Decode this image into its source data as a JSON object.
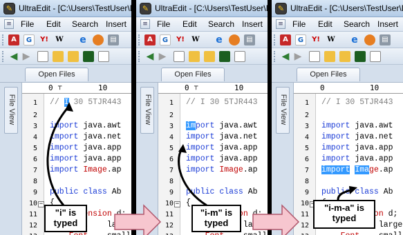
{
  "window": {
    "app_icon": "ultraedit-logo-icon",
    "title": "UltraEdit - [C:\\Users\\TestUser\\D"
  },
  "menu": [
    "File",
    "Edit",
    "Search",
    "Insert"
  ],
  "toolbar1_icons": [
    "acrobat-icon",
    "google-icon",
    "yahoo-icon",
    "wikipedia-icon",
    "ie-icon",
    "firefox-icon",
    "print-icon"
  ],
  "toolbar2_icons": [
    "back-icon",
    "forward-icon",
    "new-file-icon",
    "open-folder-icon",
    "save-icon",
    "copy-icon"
  ],
  "tabs": {
    "open_files": "Open Files"
  },
  "sidebar": {
    "file_view": "File View"
  },
  "ruler": {
    "marks": [
      "0",
      "10"
    ]
  },
  "panels": [
    {
      "lines": [
        {
          "n": "1",
          "text": "// I 30 5TJR443"
        },
        {
          "n": "2",
          "text": ""
        },
        {
          "n": "3",
          "text": "import java.awt"
        },
        {
          "n": "4",
          "text": "import java.net"
        },
        {
          "n": "5",
          "text": "import java.app"
        },
        {
          "n": "6",
          "text": "import java.app"
        },
        {
          "n": "7",
          "text": "import Image.ap"
        },
        {
          "n": "8",
          "text": ""
        },
        {
          "n": "9",
          "text": "public class Ab"
        },
        {
          "n": "10",
          "text": "{"
        },
        {
          "n": "11",
          "text": "    Dimension d;"
        },
        {
          "n": "12",
          "text": "    Font    large"
        },
        {
          "n": "13",
          "text": "    Font    small"
        }
      ],
      "callout": {
        "line1": "\"i\" is",
        "line2": "typed"
      }
    },
    {
      "lines": [
        {
          "n": "1",
          "text": "// I 30 5TJR443"
        },
        {
          "n": "2",
          "text": ""
        },
        {
          "n": "3",
          "text": "import java.awt"
        },
        {
          "n": "4",
          "text": "import java.net"
        },
        {
          "n": "5",
          "text": "import java.app"
        },
        {
          "n": "6",
          "text": "import java.app"
        },
        {
          "n": "7",
          "text": "import Image.ap"
        },
        {
          "n": "8",
          "text": ""
        },
        {
          "n": "9",
          "text": "public class Ab"
        },
        {
          "n": "10",
          "text": "{"
        },
        {
          "n": "11",
          "text": "    Dimension d;"
        },
        {
          "n": "12",
          "text": "    Font    large"
        },
        {
          "n": "13",
          "text": "    Font    small"
        }
      ],
      "callout": {
        "line1": "\"i-m\" is",
        "line2": "typed"
      }
    },
    {
      "lines": [
        {
          "n": "1",
          "text": "// I 30 5TJR443"
        },
        {
          "n": "2",
          "text": ""
        },
        {
          "n": "3",
          "text": "import java.awt"
        },
        {
          "n": "4",
          "text": "import java.net"
        },
        {
          "n": "5",
          "text": "import java.app"
        },
        {
          "n": "6",
          "text": "import java.app"
        },
        {
          "n": "7",
          "text": "import Image.ap"
        },
        {
          "n": "8",
          "text": ""
        },
        {
          "n": "9",
          "text": "public class Ab"
        },
        {
          "n": "10",
          "text": "{"
        },
        {
          "n": "11",
          "text": "    Dimension d;"
        },
        {
          "n": "12",
          "text": "    Font    large"
        },
        {
          "n": "13",
          "text": "    Font    small"
        }
      ],
      "callout": {
        "line1": "\"i-m-a\" is",
        "line2": "typed"
      }
    }
  ]
}
